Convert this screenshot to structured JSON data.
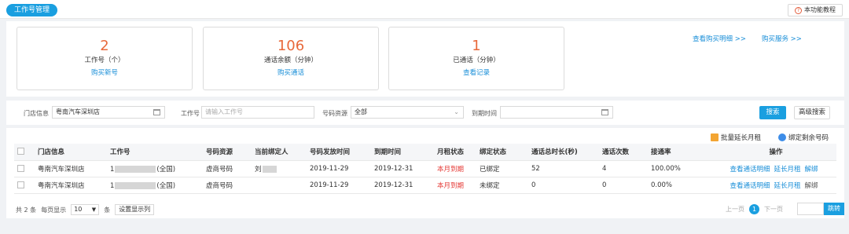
{
  "header": {
    "tab": "工作号管理",
    "tutorial": "本功能教程"
  },
  "stats": [
    {
      "value": "2",
      "label": "工作号（个）",
      "link": "购买新号"
    },
    {
      "value": "106",
      "label": "通话余额（分钟）",
      "link": "购买通话"
    },
    {
      "value": "1",
      "label": "已通话（分钟）",
      "link": "查看记录"
    }
  ],
  "top_links": {
    "purchase_detail": "查看购买明细 >>",
    "buy_service": "购买服务 >>"
  },
  "filters": {
    "store_label": "门店信息",
    "store_value": "粤南汽车深圳店",
    "work_label": "工作号",
    "work_placeholder": "请输入工作号",
    "source_label": "号码资源",
    "source_value": "全部",
    "expire_label": "到期时间",
    "search": "搜索",
    "advanced": "高级搜索"
  },
  "table_actions": {
    "extend": "批量延长月租",
    "bind": "绑定剩余号码"
  },
  "table": {
    "headers": [
      "门店信息",
      "工作号",
      "号码资源",
      "当前绑定人",
      "号码发放时间",
      "到期时间",
      "月租状态",
      "绑定状态",
      "通话总时长(秒)",
      "通话次数",
      "接通率",
      "操作"
    ],
    "rows": [
      {
        "store": "粤南汽车深圳店",
        "num_prefix": "1",
        "num_suffix": "(全国)",
        "source": "虚商号码",
        "binder": "刘",
        "issue": "2019-11-29",
        "expire": "2019-12-31",
        "rent": "本月到期",
        "bind_status": "已绑定",
        "duration": "52",
        "count": "4",
        "rate": "100.00%",
        "op1": "查看通话明细",
        "op2": "延长月租",
        "op3": "解绑"
      },
      {
        "store": "粤南汽车深圳店",
        "num_prefix": "1",
        "num_suffix": "(全国)",
        "source": "虚商号码",
        "binder": "",
        "issue": "2019-11-29",
        "expire": "2019-12-31",
        "rent": "本月到期",
        "bind_status": "未绑定",
        "duration": "0",
        "count": "0",
        "rate": "0.00%",
        "op1": "查看通话明细",
        "op2": "延长月租",
        "op3": "解绑"
      }
    ]
  },
  "pager": {
    "total": "共 2 条",
    "per_page_label": "每页显示",
    "per_page": "10",
    "unit": "条",
    "columns": "设置显示列",
    "prev": "上一页",
    "current": "1",
    "next": "下一页",
    "go": "跳转"
  }
}
